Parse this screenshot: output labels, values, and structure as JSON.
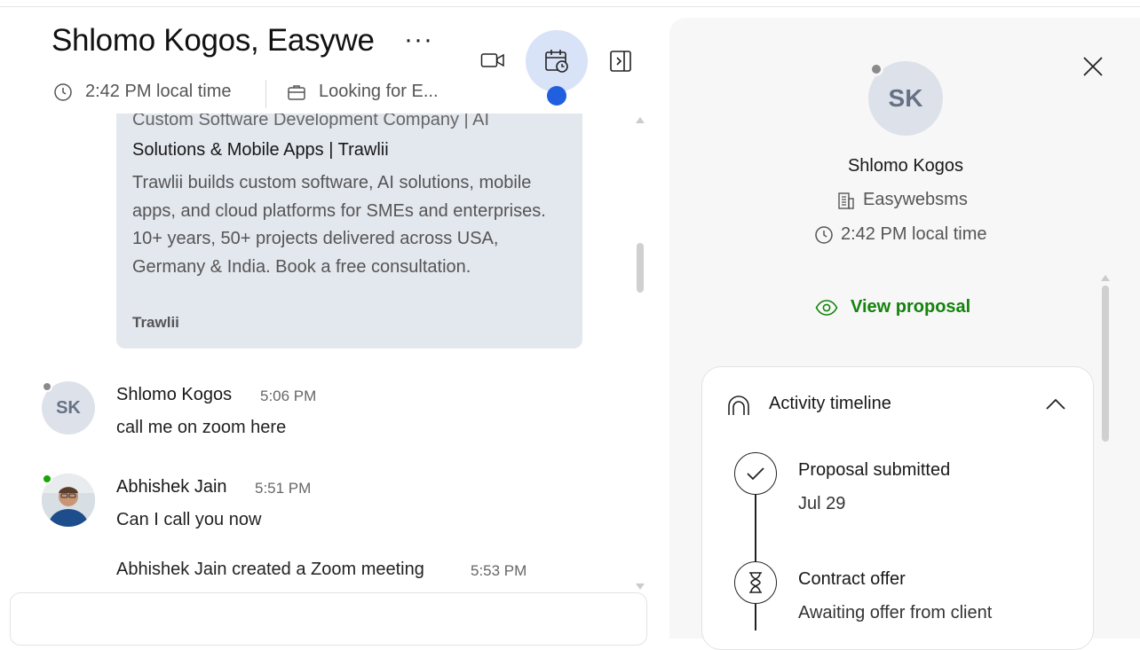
{
  "header": {
    "title": "Shlomo Kogos, Easywe",
    "more_label": "···",
    "local_time": "2:42 PM local time",
    "job": "Looking for E..."
  },
  "link_preview": {
    "title_line1": "Custom Software Development Company | AI",
    "title_line2": "Solutions & Mobile Apps | Trawlii",
    "description": "Trawlii builds custom software, AI solutions, mobile apps, and cloud platforms for SMEs and enterprises. 10+ years, 50+ projects delivered across USA, Germany & India. Book a free consultation.",
    "site": "Trawlii"
  },
  "messages": [
    {
      "avatar_initials": "SK",
      "name": "Shlomo Kogos",
      "time": "5:06 PM",
      "text": "call me on zoom here",
      "status_color": "#8a8a8a"
    },
    {
      "avatar_initials": "",
      "name": "Abhishek Jain",
      "time": "5:51 PM",
      "text": "Can I call you now",
      "status_color": "#14a800"
    }
  ],
  "event": {
    "name": "Abhishek Jain",
    "action": " created a Zoom meeting",
    "time": "5:53 PM"
  },
  "profile": {
    "initials": "SK",
    "name": "Shlomo Kogos",
    "company": "Easywebsms",
    "local_time": "2:42 PM local time",
    "view_proposal": "View proposal"
  },
  "timeline": {
    "heading": "Activity timeline",
    "steps": [
      {
        "title": "Proposal submitted",
        "sub": "Jul 29",
        "icon": "check-icon"
      },
      {
        "title": "Contract offer",
        "sub": "Awaiting offer from client",
        "icon": "hourglass-icon"
      }
    ]
  },
  "colors": {
    "accent_green": "#14830d",
    "highlight_blue": "#1f5fe0",
    "card_gray": "#e3e7ee"
  }
}
